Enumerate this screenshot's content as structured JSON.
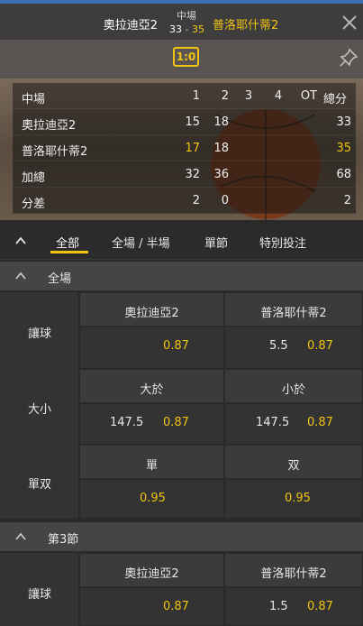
{
  "header": {
    "home_team": "奧拉迪亞2",
    "away_team": "普洛耶什蒂2",
    "stage": "中場",
    "home_score": "33",
    "separator": " - ",
    "away_score": "35"
  },
  "status": {
    "badge": "1:0"
  },
  "scoreboard": {
    "headers": [
      "中場",
      "1",
      "2",
      "3",
      "4",
      "OT",
      "總分"
    ],
    "rows": [
      {
        "name": "奧拉迪亞2",
        "q1": "15",
        "q2": "18",
        "q3": "",
        "q4": "",
        "ot": "",
        "total": "33"
      },
      {
        "name": "普洛耶什蒂2",
        "q1": "17",
        "q2": "18",
        "q3": "",
        "q4": "",
        "ot": "",
        "total": "35"
      },
      {
        "name": "加總",
        "q1": "32",
        "q2": "36",
        "q3": "",
        "q4": "",
        "ot": "",
        "total": "68"
      },
      {
        "name": "分差",
        "q1": "2",
        "q2": "0",
        "q3": "",
        "q4": "",
        "ot": "",
        "total": "2"
      }
    ]
  },
  "tabs": [
    {
      "label": "全部",
      "active": true
    },
    {
      "label": "全場 / 半場",
      "active": false
    },
    {
      "label": "單節",
      "active": false
    },
    {
      "label": "特別投注",
      "active": false
    }
  ],
  "sections": [
    {
      "title": "全場",
      "markets": [
        {
          "label": "讓球",
          "left_header": "奧拉迪亞2",
          "right_header": "普洛耶什蒂2",
          "left_handicap": "",
          "left_odds": "0.87",
          "right_handicap": "5.5",
          "right_odds": "0.87"
        },
        {
          "label": "大小",
          "left_header": "大於",
          "right_header": "小於",
          "left_handicap": "147.5",
          "left_odds": "0.87",
          "right_handicap": "147.5",
          "right_odds": "0.87"
        },
        {
          "label": "單双",
          "left_header": "單",
          "right_header": "双",
          "left_handicap": "",
          "left_odds": "0.95",
          "right_handicap": "",
          "right_odds": "0.95"
        }
      ]
    },
    {
      "title": "第3節",
      "markets": [
        {
          "label": "讓球",
          "left_header": "奧拉迪亞2",
          "right_header": "普洛耶什蒂2",
          "left_handicap": "",
          "left_odds": "0.87",
          "right_handicap": "1.5",
          "right_odds": "0.87"
        }
      ]
    }
  ],
  "colors": {
    "accent": "#f1c40f",
    "top_border": "#3a6fb6"
  },
  "icons": {
    "close": "close-icon",
    "pin": "pin-icon",
    "collapse": "chevron-up-icon"
  }
}
